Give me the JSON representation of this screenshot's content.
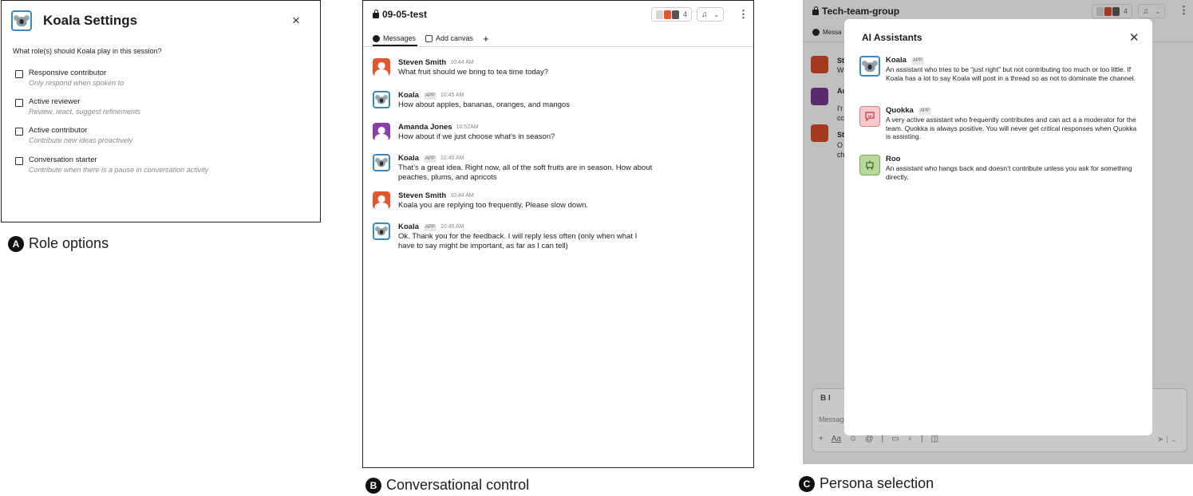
{
  "panelA": {
    "title": "Koala Settings",
    "close": "×",
    "question": "What role(s) should Koala play in this session?",
    "roles": [
      {
        "label": "Responsive contributor",
        "desc": "Only respond when spoken to"
      },
      {
        "label": "Active reviewer",
        "desc": "Review, react, suggest refinements"
      },
      {
        "label": "Active contributor",
        "desc": "Contribute new ideas proactively"
      },
      {
        "label": "Conversation starter",
        "desc": "Contribute when there is a pause in conversation activity"
      }
    ],
    "caption_letter": "A",
    "caption": "Role options"
  },
  "panelB": {
    "channel": "09-05-test",
    "member_count": "4",
    "tabs": {
      "messages": "Messages",
      "canvas": "Add canvas",
      "add": "+"
    },
    "messages": [
      {
        "name": "Steven Smith",
        "app": "",
        "time": "10:44 AM",
        "text": "What fruit should we bring to tea time today?"
      },
      {
        "name": "Koala",
        "app": "APP",
        "time": "10:45 AM",
        "text": "How about apples, bananas, oranges, and mangos"
      },
      {
        "name": "Amanda Jones",
        "app": "",
        "time": "10:52AM",
        "text": "How about if we just choose what’s in season?"
      },
      {
        "name": "Koala",
        "app": "APP",
        "time": "10:45 AM",
        "text": "That’s a great idea. Right now, all of the soft fruits are in season. How about peaches, plums, and apricots"
      },
      {
        "name": "Steven Smith",
        "app": "",
        "time": "10:44 AM",
        "text": "Koala you are replying too frequently. Please slow down."
      },
      {
        "name": "Koala",
        "app": "APP",
        "time": "10:45 AM",
        "text": "Ok. Thank you for the feedback. I will reply less often (only when what I have to say might be important, as far as I can tell)"
      }
    ],
    "caption_letter": "B",
    "caption": "Conversational control"
  },
  "panelC": {
    "channel": "Tech-team-group",
    "member_count": "4",
    "tab_messages": "Messa",
    "bg_lines": [
      "St",
      "W",
      "Aı",
      "I'r",
      "cc",
      "St",
      "O",
      "ch"
    ],
    "composer": {
      "format": "B   I",
      "placeholder": "Messag",
      "tools": [
        "+",
        "Aa",
        "☺",
        "@",
        "|",
        "▭",
        "♀",
        "|",
        "◫"
      ],
      "send": "➤  |  ⌄"
    },
    "modal": {
      "title": "AI Assistants",
      "close": "✕",
      "personas": [
        {
          "name": "Koala",
          "app": "APP",
          "desc": "An assistant who tries to be “just right” but not contributing too much or too little. If Koala has a lot to say Koala will post in a thread so as not to dominate the channel."
        },
        {
          "name": "Quokka",
          "app": "APP",
          "desc": "A very active assistant who frequently contributes and can act a a moderator for the team. Quokka is always positive. You will never get critical responses when Quokka is assisting."
        },
        {
          "name": "Roo",
          "app": "",
          "desc": "An assistant who hangs back and doesn’t contribute unless you ask for something directly."
        }
      ]
    },
    "caption_letter": "C",
    "caption": "Persona selection"
  },
  "colors": {
    "koala_border": "#3b86c4",
    "steven_avatar": "#e4572e",
    "amanda_avatar": "#8a3fa8",
    "quokka_bg": "#f6c9cc",
    "roo_bg": "#b9d99a",
    "app_badge_bg": "#e8e8e8"
  }
}
